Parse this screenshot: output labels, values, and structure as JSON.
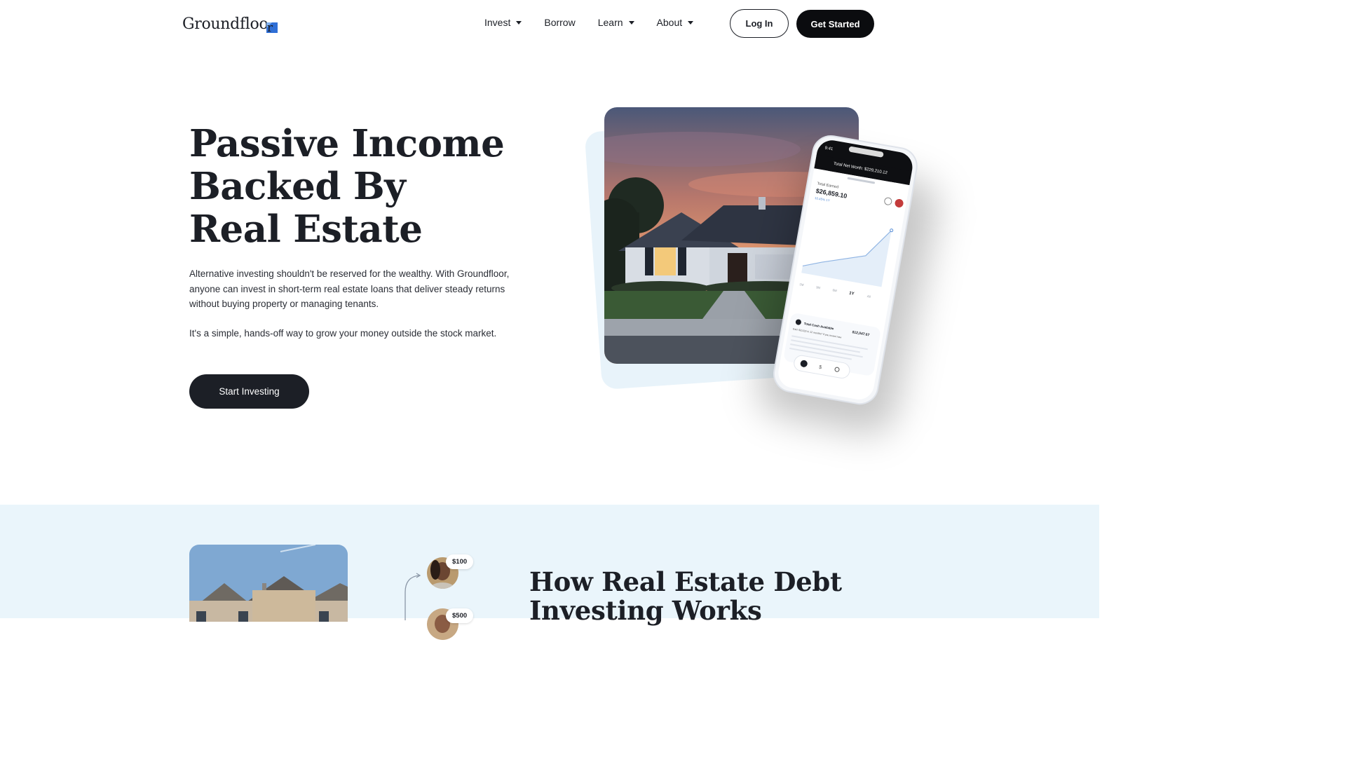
{
  "header": {
    "logo_text": "Groundfloo",
    "logo_mark_letter": "r",
    "nav": [
      {
        "label": "Invest",
        "has_dropdown": true
      },
      {
        "label": "Borrow",
        "has_dropdown": false
      },
      {
        "label": "Learn",
        "has_dropdown": true
      },
      {
        "label": "About",
        "has_dropdown": true
      }
    ],
    "login_label": "Log In",
    "get_started_label": "Get Started"
  },
  "hero": {
    "title_lines": [
      "Passive Income",
      "Backed By",
      "Real Estate"
    ],
    "paragraph1": "Alternative investing shouldn't be reserved for the wealthy. With Groundfloor, anyone can invest in short-term real estate loans that deliver steady returns without buying property or managing tenants.",
    "paragraph2": "It's a simple, hands-off way to grow your money outside the stock market.",
    "cta_label": "Start Investing"
  },
  "phone": {
    "time": "9:41",
    "net_worth": "Total Net Worth: $229,210.12",
    "total_earned_label": "Total Earned",
    "total_earned_value": "$26,859.10",
    "total_earned_change": "10.45% 1Y",
    "ranges": [
      "1M",
      "3M",
      "6M",
      "1Y",
      "All"
    ],
    "selected_range": "1Y",
    "cash_label": "Total Cash Available",
    "cash_value": "$12,047.67",
    "cash_sub": "Earn $2,023 in 12 months* if you invest now"
  },
  "section2": {
    "title_lines": [
      "How Real Estate Debt",
      "Investing Works"
    ],
    "amounts": [
      "$100",
      "$500"
    ]
  },
  "colors": {
    "dark": "#1c1f26",
    "black": "#0b0c0f",
    "section_bg": "#eaf5fb",
    "logo_accent": "#2f6fd6"
  }
}
